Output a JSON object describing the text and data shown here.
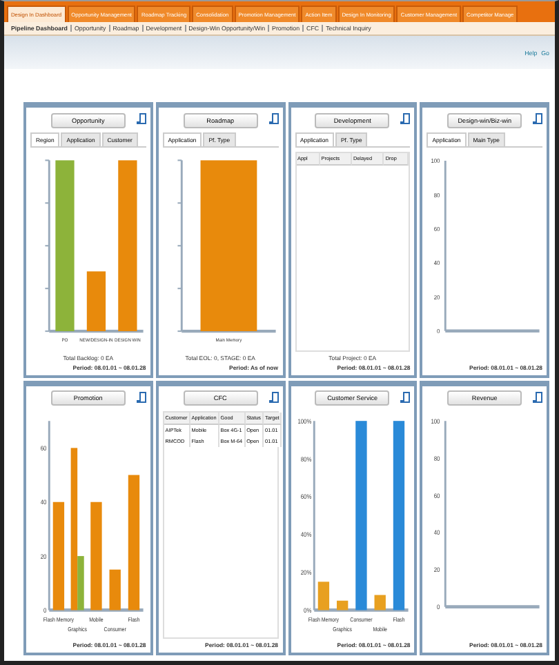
{
  "main_tabs": [
    {
      "label": "Design In Dashboard",
      "selected": true
    },
    {
      "label": "Opportunity Management",
      "selected": false
    },
    {
      "label": "Roadmap Tracking",
      "selected": false
    },
    {
      "label": "Consolidation",
      "selected": false
    },
    {
      "label": "Promotion Management",
      "selected": false
    },
    {
      "label": "Action Item",
      "selected": false
    },
    {
      "label": "Design In Monitoring",
      "selected": false
    },
    {
      "label": "Customer Management",
      "selected": false
    },
    {
      "label": "Competitor Manage",
      "selected": false
    }
  ],
  "sub_tabs": [
    {
      "label": "Pipeline Dashboard",
      "selected": true
    },
    {
      "label": "Opportunity",
      "selected": false
    },
    {
      "label": "Roadmap",
      "selected": false
    },
    {
      "label": "Development",
      "selected": false
    },
    {
      "label": "Design-Win Opportunity/Win",
      "selected": false
    },
    {
      "label": "Promotion",
      "selected": false
    },
    {
      "label": "CFC",
      "selected": false
    },
    {
      "label": "Technical Inquiry",
      "selected": false
    }
  ],
  "util_links": [
    "Help",
    "Go"
  ],
  "panels": [
    {
      "title": "Opportunity",
      "kind": "bar_sketch",
      "tabs": [
        {
          "label": "Region",
          "selected": true
        },
        {
          "label": "Application",
          "selected": false
        },
        {
          "label": "Customer",
          "selected": false
        }
      ],
      "categories": [
        "PO",
        "NEW/DESIGN-IN",
        "DESIGN WIN"
      ],
      "notes": [
        "Total Backlog: 0 EA"
      ],
      "period": "Period: 08.01.01 ~ 08.01.28"
    },
    {
      "title": "Roadmap",
      "kind": "bar_sketch",
      "tabs": [
        {
          "label": "Application",
          "selected": true
        },
        {
          "label": "Pf. Type",
          "selected": false
        }
      ],
      "categories": [
        "Main Memory"
      ],
      "notes": [
        "Total EOL: 0, STAGE: 0 EA"
      ],
      "period": "Period: As of now"
    },
    {
      "title": "Development",
      "kind": "table",
      "tabs": [
        {
          "label": "Application",
          "selected": true
        },
        {
          "label": "Pf. Type",
          "selected": false
        }
      ],
      "columns": [
        "Appl",
        "Projects",
        "Delayed",
        "Drop"
      ],
      "notes": [
        "Total Project: 0 EA"
      ],
      "period": "Period: 08.01.01 ~ 08.01.28"
    },
    {
      "title": "Design-win/Biz-win",
      "kind": "empty_plot",
      "tabs": [
        {
          "label": "Application",
          "selected": true
        },
        {
          "label": "Main Type",
          "selected": false
        }
      ],
      "y_labels": [
        "100",
        "80",
        "60",
        "40",
        "20",
        "0"
      ],
      "period": "Period: 08.01.01 ~ 08.01.28"
    },
    {
      "title": "Promotion",
      "kind": "chart",
      "chart_data": {
        "type": "bar",
        "categories": [
          "Flash Memory",
          "Graphics",
          "Mobile",
          "Consumer",
          "Flash"
        ],
        "ylim": [
          0,
          70
        ],
        "yticks": [
          0,
          20,
          40,
          60
        ],
        "series": [
          {
            "color": "#e88a0c",
            "values": [
              40,
              60,
              40,
              15,
              50
            ]
          },
          {
            "color": "#8db33a",
            "values": [
              null,
              20,
              null,
              null,
              null
            ]
          }
        ]
      },
      "period": "Period: 08.01.01 ~ 08.01.28"
    },
    {
      "title": "CFC",
      "kind": "table",
      "columns": [
        "Customer",
        "Application",
        "Good",
        "Status",
        "Target"
      ],
      "rows": [
        [
          "AIPTek",
          "Mobile",
          "Box 4G-1",
          "Open",
          "01.01"
        ],
        [
          "RMCOD",
          "Flash",
          "Box M-64",
          "Open",
          "01.01"
        ]
      ],
      "period": "Period: 08.01.01 ~ 08.01.28"
    },
    {
      "title": "Customer Service",
      "kind": "chart",
      "chart_data": {
        "type": "bar",
        "categories": [
          "Flash Memory",
          "Graphics",
          "Consumer",
          "Mobile",
          "Flash"
        ],
        "ylim": [
          0,
          100
        ],
        "yticks": [
          {
            "value": 0,
            "label": "0%"
          },
          {
            "value": 20,
            "label": "20%"
          },
          {
            "value": 40,
            "label": "40%"
          },
          {
            "value": 60,
            "label": "60%"
          },
          {
            "value": 80,
            "label": "80%"
          },
          {
            "value": 100,
            "label": "100%"
          }
        ],
        "series": [
          {
            "color": "#e8a020",
            "values": [
              15,
              5,
              null,
              8,
              null
            ]
          },
          {
            "color": "#2a8ad8",
            "values": [
              null,
              null,
              100,
              null,
              100
            ]
          }
        ]
      },
      "period": "Period: 08.01.01 ~ 08.01.28"
    },
    {
      "title": "Revenue",
      "kind": "empty_plot",
      "y_labels": [
        "100",
        "80",
        "60",
        "40",
        "20",
        "0"
      ],
      "period": "Period: 08.01.01 ~ 08.01.28"
    }
  ]
}
